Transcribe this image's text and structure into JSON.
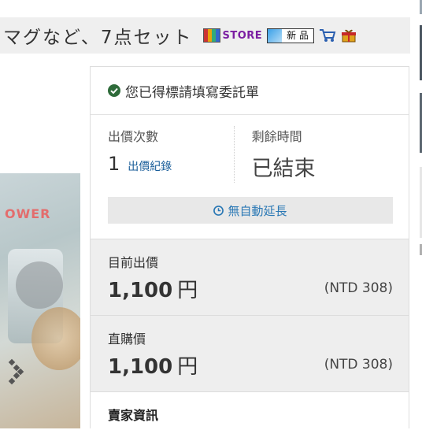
{
  "title_bar": {
    "title": "マグなど、7点セット",
    "store_badge": "STORE",
    "new_badge": "新 品"
  },
  "status": {
    "message": "您已得標請填寫委託單"
  },
  "stats": {
    "bid_count_label": "出價次數",
    "bid_count_value": "1",
    "bid_history_link": "出價紀錄",
    "time_left_label": "剩餘時間",
    "time_left_value": "已結束"
  },
  "auto_extend": "無自動延長",
  "current_price": {
    "label": "目前出價",
    "amount": "1,100",
    "unit": "円",
    "converted": "(NTD 308)"
  },
  "buy_now_price": {
    "label": "直購價",
    "amount": "1,100",
    "unit": "円",
    "converted": "(NTD 308)"
  },
  "seller": {
    "label": "賣家資訊"
  },
  "product_image": {
    "brand_text": "OWER"
  },
  "colors": {
    "accent": "#1a5e9a",
    "success": "#2e7d32",
    "panel_gray": "#eeeeee"
  }
}
